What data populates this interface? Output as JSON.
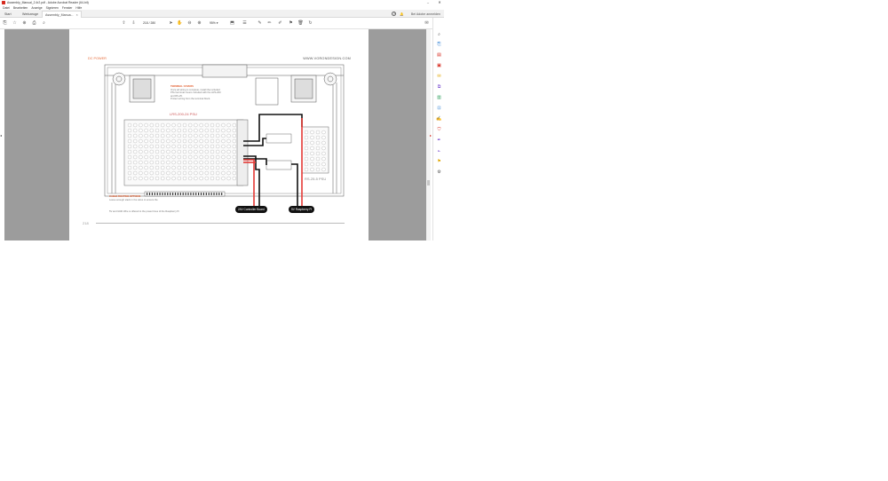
{
  "window": {
    "title": "Assembly_Manual_2.4r2.pdf - Adobe Acrobat Reader (64-bit)",
    "minimize_glyph": "–",
    "close_glyph": "✕"
  },
  "menu": [
    "Datei",
    "Bearbeiten",
    "Anzeige",
    "Signieren",
    "Fenster",
    "Hilfe"
  ],
  "tabs": {
    "start": "Start",
    "tools": "Werkzeuge",
    "document": "Assembly_Manua...",
    "close_glyph": "×"
  },
  "account": {
    "help_glyph": "?",
    "bell_glyph": "🔔",
    "signin_label": "Bei Adobe anmelden"
  },
  "toolbar": {
    "page_value": "218",
    "page_total": "/ 280",
    "zoom_value": "95%",
    "zoom_caret": "▾"
  },
  "document": {
    "header_left": "DC POWER",
    "header_right": "WWW.VORONDESIGN.COM",
    "page_number": "218",
    "psu_main_label": "LRS-200-24 PSU",
    "psu_small_label": "RS-25-5 PSU",
    "callout_top": {
      "head": "TERMINAL COVERS",
      "lines": [
        "Once all wiring is complete, install the included",
        "PSU terminal covers included with the LRS-200",
        "and RS-25.",
        "Protect wiring from the terminal block."
      ]
    },
    "callout_bottom": {
      "head": "CABLE ROUTING OPTIONS",
      "line1": "Leave enough slack in the wires to ensure the",
      "line2": "5V and GND Wire is offered to the power lines of the Raspberry Pi"
    },
    "wire_label_1": "24V Controller Board",
    "wire_label_2": "5V Raspberry Pi"
  },
  "colors": {
    "accent": "#e25c2c",
    "wire_red": "#e53935",
    "wire_black": "#111111",
    "viewport_bg": "#9c9c9c"
  }
}
